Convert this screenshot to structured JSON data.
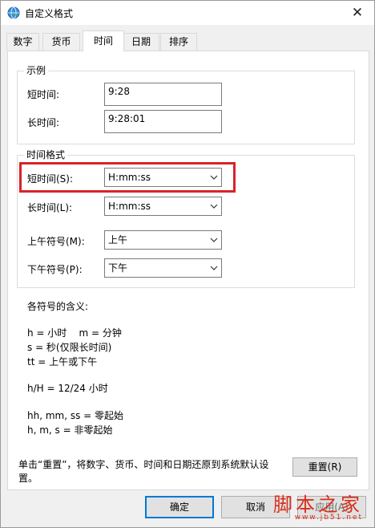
{
  "window": {
    "title": "自定义格式",
    "close_glyph": "✕"
  },
  "tabs": [
    {
      "label": "数字"
    },
    {
      "label": "货币"
    },
    {
      "label": "时间",
      "active": true
    },
    {
      "label": "日期"
    },
    {
      "label": "排序"
    }
  ],
  "example_group": {
    "title": "示例",
    "short_time_label": "短时间:",
    "short_time_value": "9:28",
    "long_time_label": "长时间:",
    "long_time_value": "9:28:01"
  },
  "format_group": {
    "title": "时间格式",
    "short_time_label": "短时间(S):",
    "short_time_value": "H:mm:ss",
    "long_time_label": "长时间(L):",
    "long_time_value": "H:mm:ss",
    "am_label": "上午符号(M):",
    "am_value": "上午",
    "pm_label": "下午符号(P):",
    "pm_value": "下午"
  },
  "help": {
    "heading": "各符号的含义:",
    "lines": [
      "h = 小时    m = 分钟",
      "s = 秒(仅限长时间)",
      "tt = 上午或下午",
      "h/H = 12/24 小时",
      "hh, mm, ss = 零起始",
      "h, m, s = 非零起始"
    ]
  },
  "reset_note": {
    "line1": "单击“重置”，将数字、货币、时间和日期还原到系统默认设置。",
    "line2": "置。"
  },
  "reset_note_text": "单击“重置”，将数字、货币、时间和日期还原到系统默认设",
  "buttons": {
    "reset": "重置(R)",
    "ok": "确定",
    "cancel": "取消",
    "apply": "应用(A)"
  },
  "watermark": {
    "main": "脚本之家",
    "sub": "www.jb51.net"
  },
  "colors": {
    "highlight": "#d8232a",
    "watermark": "#d9301c",
    "accent": "#0078d7"
  }
}
